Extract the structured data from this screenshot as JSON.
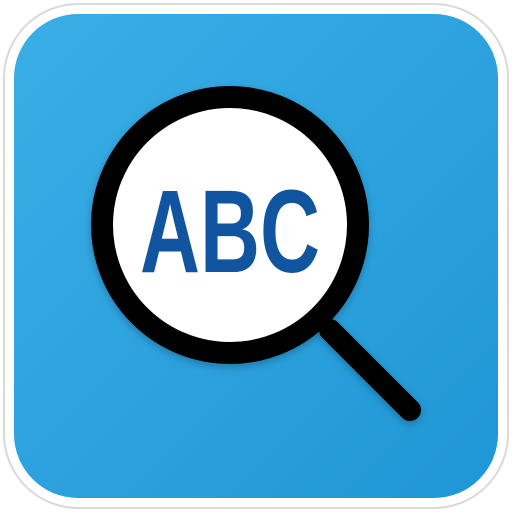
{
  "icon": {
    "name": "magnifier-abc-icon",
    "lens_text": "ABC"
  },
  "colors": {
    "outer_frame": "#ffffff",
    "outer_frame_border": "#d9d9d9",
    "tile_light": "#3aaee6",
    "tile_dark": "#1f96d6",
    "magnifier_ring": "#000000",
    "lens_fill": "#ffffff",
    "text": "#1155a0"
  }
}
